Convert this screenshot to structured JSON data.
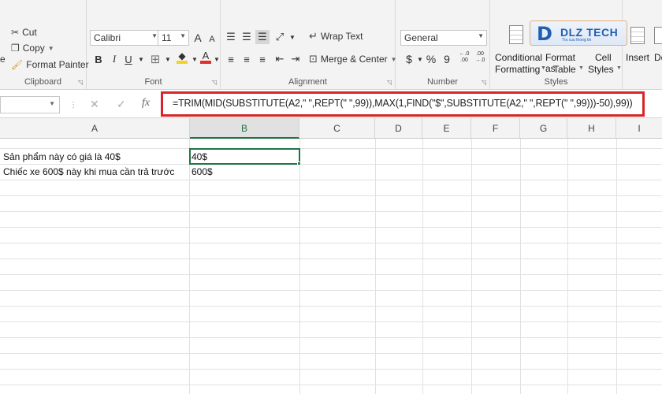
{
  "clipboard": {
    "cut": "Cut",
    "copy": "Copy",
    "format_painter": "Format Painter",
    "group": "Clipboard",
    "paste_fragment": "e"
  },
  "font": {
    "family": "Calibri",
    "size": "11",
    "group": "Font",
    "bold": "B",
    "italic": "I",
    "underline": "U",
    "grow": "A",
    "shrink": "A"
  },
  "alignment": {
    "wrap_text": "Wrap Text",
    "merge_center": "Merge & Center",
    "group": "Alignment"
  },
  "number": {
    "format": "General",
    "currency": "$",
    "percent": "%",
    "comma": "9",
    "inc_decimal": "←.0\n.00",
    "group": "Number"
  },
  "styles": {
    "conditional_1": "Conditional",
    "conditional_2": "Formatting",
    "format_table_1": "Format as",
    "format_table_2": "Table",
    "cell_styles_1": "Cell",
    "cell_styles_2": "Styles",
    "group": "Styles"
  },
  "cells": {
    "insert": "Insert",
    "de": "De"
  },
  "logo": {
    "mark": "D",
    "text": "DLZ TECH",
    "sub": "Tra cuu thong tin"
  },
  "formula_bar": {
    "cancel": "✕",
    "enter": "✓",
    "fx": "fx",
    "formula": "=TRIM(MID(SUBSTITUTE(A2,\" \",REPT(\" \",99)),MAX(1,FIND(\"$\",SUBSTITUTE(A2,\" \",REPT(\" \",99)))-50),99))"
  },
  "columns": [
    "A",
    "B",
    "C",
    "D",
    "E",
    "F",
    "G",
    "H",
    "I"
  ],
  "rows": [
    {
      "a": "Sản phẩm này có giá là 40$",
      "b": "40$"
    },
    {
      "a": "Chiếc xe 600$ này khi mua cần trả trước",
      "b": "600$"
    }
  ],
  "colors": {
    "accent": "#217346",
    "highlight": "#d7262b",
    "font_red": "#e0302a",
    "fill_yellow": "#f2d224"
  }
}
